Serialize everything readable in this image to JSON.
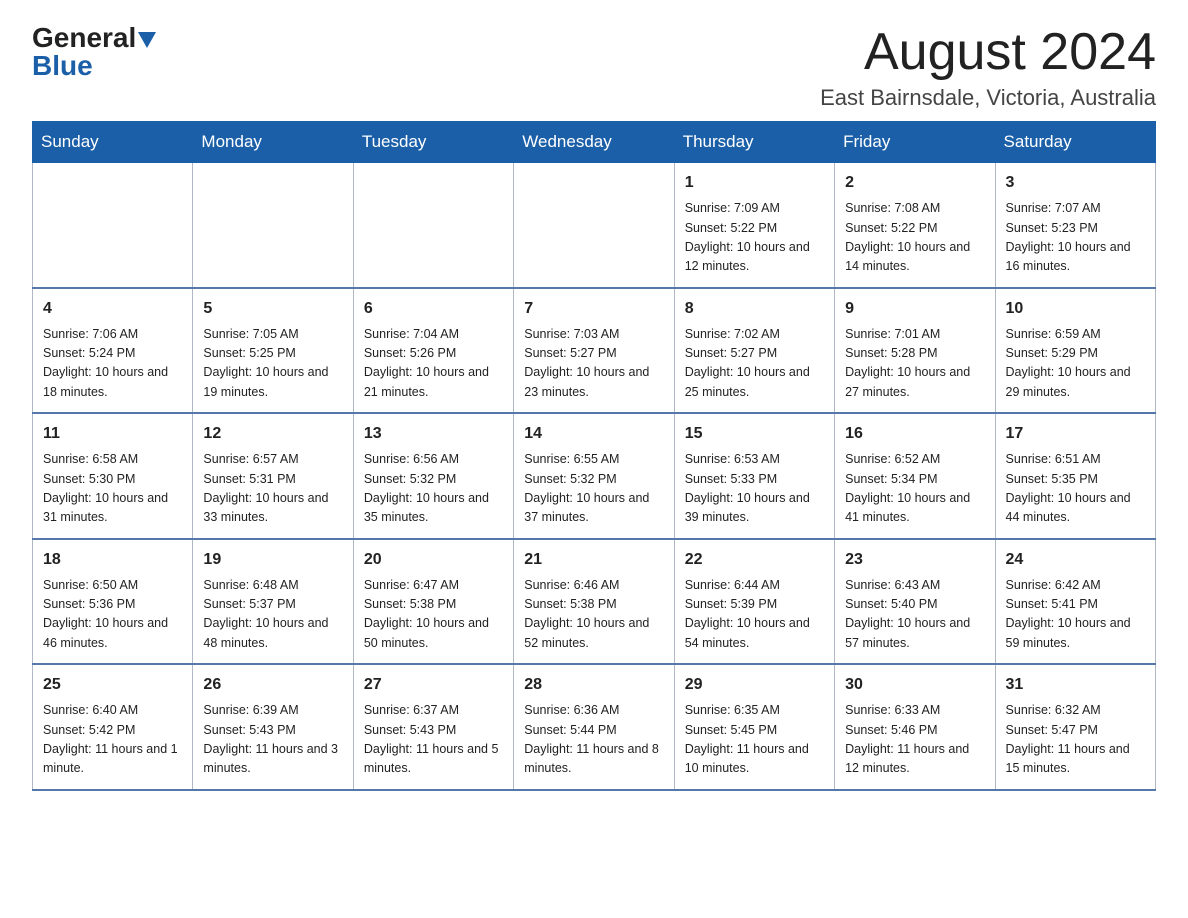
{
  "header": {
    "logo_general": "General",
    "logo_blue": "Blue",
    "month_title": "August 2024",
    "location": "East Bairnsdale, Victoria, Australia"
  },
  "calendar": {
    "days_of_week": [
      "Sunday",
      "Monday",
      "Tuesday",
      "Wednesday",
      "Thursday",
      "Friday",
      "Saturday"
    ],
    "weeks": [
      [
        {
          "day": "",
          "info": ""
        },
        {
          "day": "",
          "info": ""
        },
        {
          "day": "",
          "info": ""
        },
        {
          "day": "",
          "info": ""
        },
        {
          "day": "1",
          "info": "Sunrise: 7:09 AM\nSunset: 5:22 PM\nDaylight: 10 hours and 12 minutes."
        },
        {
          "day": "2",
          "info": "Sunrise: 7:08 AM\nSunset: 5:22 PM\nDaylight: 10 hours and 14 minutes."
        },
        {
          "day": "3",
          "info": "Sunrise: 7:07 AM\nSunset: 5:23 PM\nDaylight: 10 hours and 16 minutes."
        }
      ],
      [
        {
          "day": "4",
          "info": "Sunrise: 7:06 AM\nSunset: 5:24 PM\nDaylight: 10 hours and 18 minutes."
        },
        {
          "day": "5",
          "info": "Sunrise: 7:05 AM\nSunset: 5:25 PM\nDaylight: 10 hours and 19 minutes."
        },
        {
          "day": "6",
          "info": "Sunrise: 7:04 AM\nSunset: 5:26 PM\nDaylight: 10 hours and 21 minutes."
        },
        {
          "day": "7",
          "info": "Sunrise: 7:03 AM\nSunset: 5:27 PM\nDaylight: 10 hours and 23 minutes."
        },
        {
          "day": "8",
          "info": "Sunrise: 7:02 AM\nSunset: 5:27 PM\nDaylight: 10 hours and 25 minutes."
        },
        {
          "day": "9",
          "info": "Sunrise: 7:01 AM\nSunset: 5:28 PM\nDaylight: 10 hours and 27 minutes."
        },
        {
          "day": "10",
          "info": "Sunrise: 6:59 AM\nSunset: 5:29 PM\nDaylight: 10 hours and 29 minutes."
        }
      ],
      [
        {
          "day": "11",
          "info": "Sunrise: 6:58 AM\nSunset: 5:30 PM\nDaylight: 10 hours and 31 minutes."
        },
        {
          "day": "12",
          "info": "Sunrise: 6:57 AM\nSunset: 5:31 PM\nDaylight: 10 hours and 33 minutes."
        },
        {
          "day": "13",
          "info": "Sunrise: 6:56 AM\nSunset: 5:32 PM\nDaylight: 10 hours and 35 minutes."
        },
        {
          "day": "14",
          "info": "Sunrise: 6:55 AM\nSunset: 5:32 PM\nDaylight: 10 hours and 37 minutes."
        },
        {
          "day": "15",
          "info": "Sunrise: 6:53 AM\nSunset: 5:33 PM\nDaylight: 10 hours and 39 minutes."
        },
        {
          "day": "16",
          "info": "Sunrise: 6:52 AM\nSunset: 5:34 PM\nDaylight: 10 hours and 41 minutes."
        },
        {
          "day": "17",
          "info": "Sunrise: 6:51 AM\nSunset: 5:35 PM\nDaylight: 10 hours and 44 minutes."
        }
      ],
      [
        {
          "day": "18",
          "info": "Sunrise: 6:50 AM\nSunset: 5:36 PM\nDaylight: 10 hours and 46 minutes."
        },
        {
          "day": "19",
          "info": "Sunrise: 6:48 AM\nSunset: 5:37 PM\nDaylight: 10 hours and 48 minutes."
        },
        {
          "day": "20",
          "info": "Sunrise: 6:47 AM\nSunset: 5:38 PM\nDaylight: 10 hours and 50 minutes."
        },
        {
          "day": "21",
          "info": "Sunrise: 6:46 AM\nSunset: 5:38 PM\nDaylight: 10 hours and 52 minutes."
        },
        {
          "day": "22",
          "info": "Sunrise: 6:44 AM\nSunset: 5:39 PM\nDaylight: 10 hours and 54 minutes."
        },
        {
          "day": "23",
          "info": "Sunrise: 6:43 AM\nSunset: 5:40 PM\nDaylight: 10 hours and 57 minutes."
        },
        {
          "day": "24",
          "info": "Sunrise: 6:42 AM\nSunset: 5:41 PM\nDaylight: 10 hours and 59 minutes."
        }
      ],
      [
        {
          "day": "25",
          "info": "Sunrise: 6:40 AM\nSunset: 5:42 PM\nDaylight: 11 hours and 1 minute."
        },
        {
          "day": "26",
          "info": "Sunrise: 6:39 AM\nSunset: 5:43 PM\nDaylight: 11 hours and 3 minutes."
        },
        {
          "day": "27",
          "info": "Sunrise: 6:37 AM\nSunset: 5:43 PM\nDaylight: 11 hours and 5 minutes."
        },
        {
          "day": "28",
          "info": "Sunrise: 6:36 AM\nSunset: 5:44 PM\nDaylight: 11 hours and 8 minutes."
        },
        {
          "day": "29",
          "info": "Sunrise: 6:35 AM\nSunset: 5:45 PM\nDaylight: 11 hours and 10 minutes."
        },
        {
          "day": "30",
          "info": "Sunrise: 6:33 AM\nSunset: 5:46 PM\nDaylight: 11 hours and 12 minutes."
        },
        {
          "day": "31",
          "info": "Sunrise: 6:32 AM\nSunset: 5:47 PM\nDaylight: 11 hours and 15 minutes."
        }
      ]
    ]
  }
}
